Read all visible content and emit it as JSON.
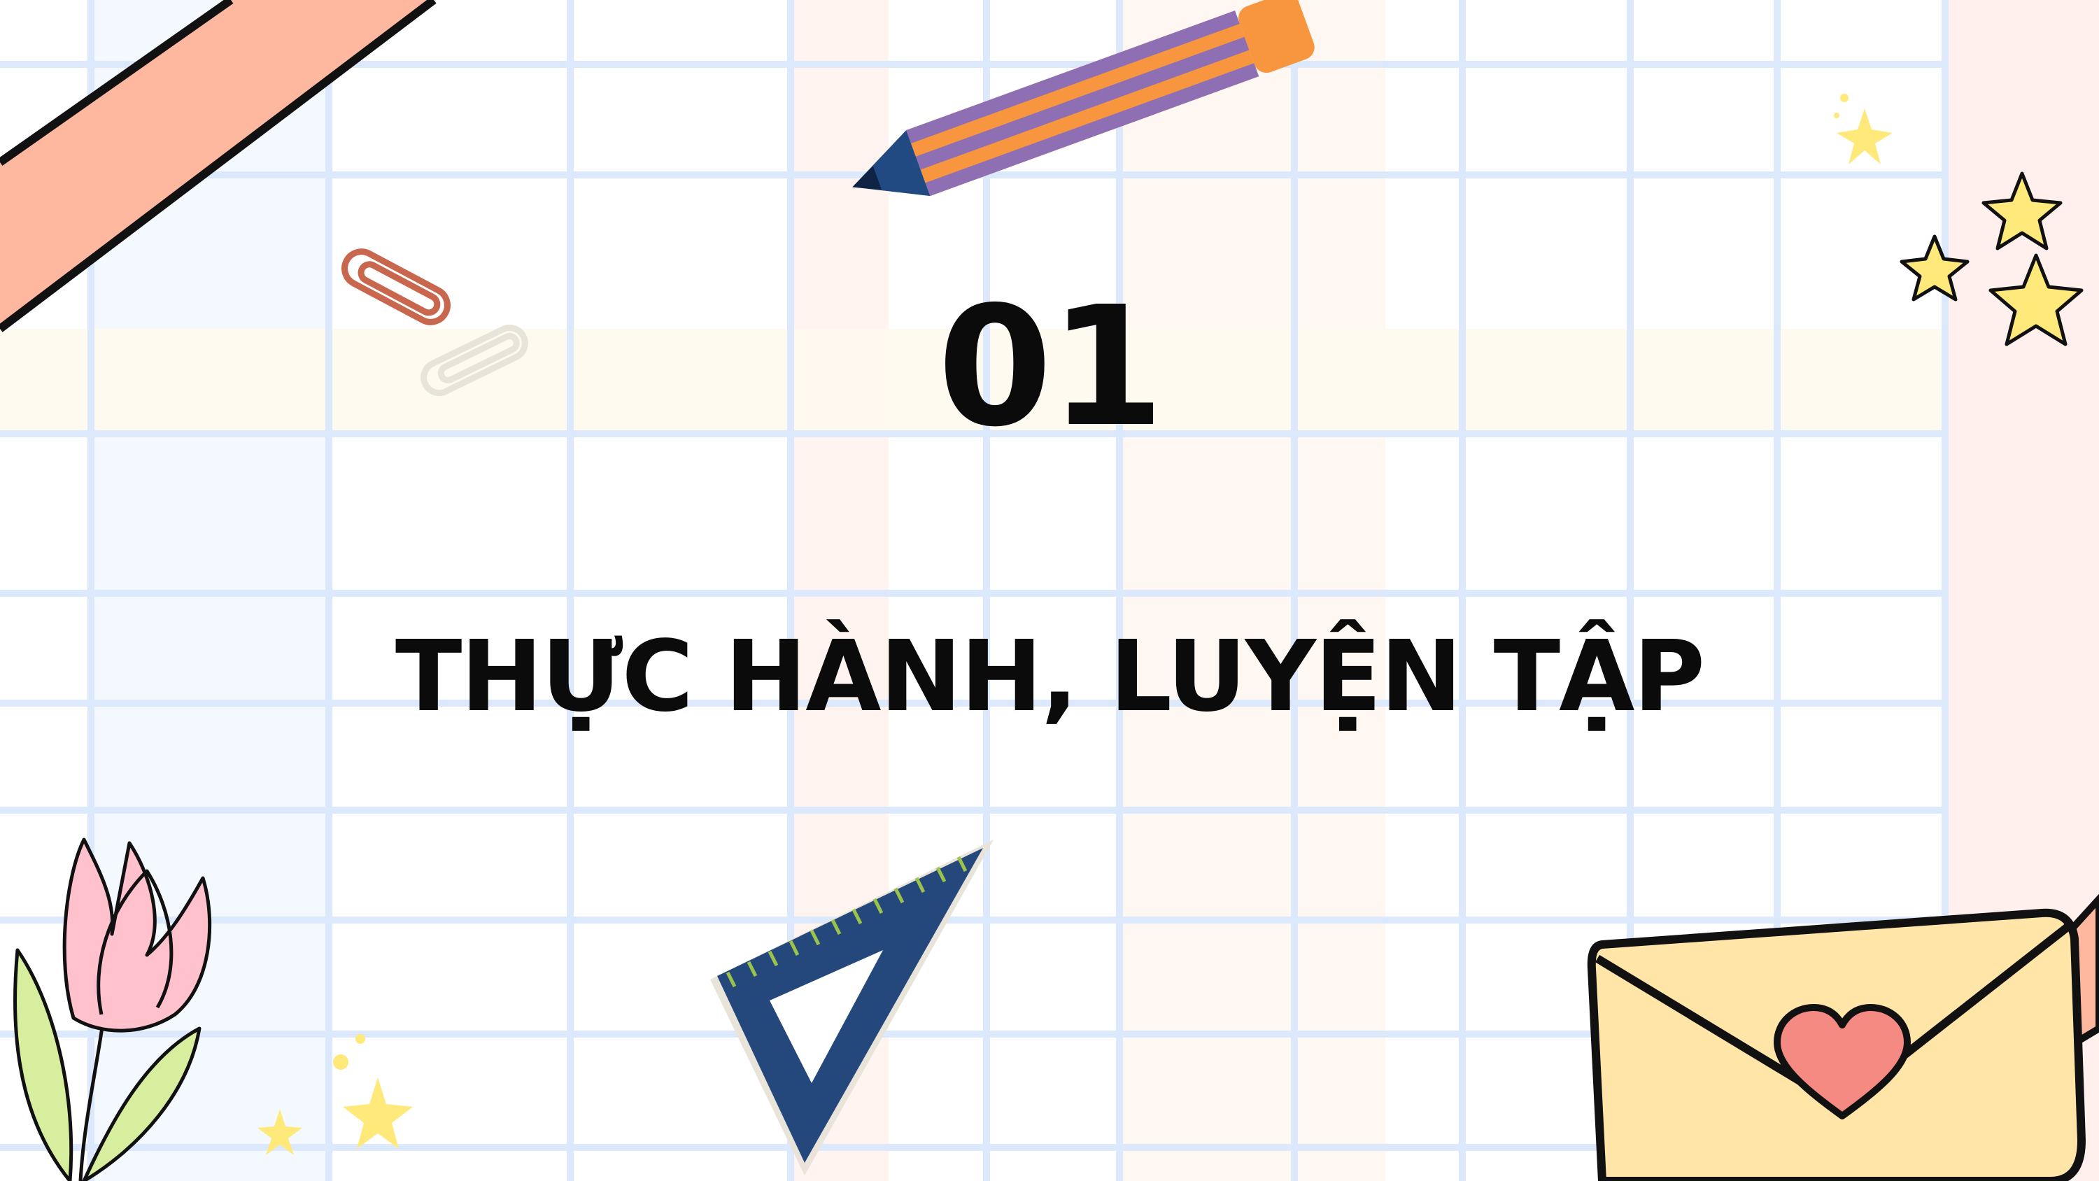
{
  "slide": {
    "number": "01",
    "title": "THỰC HÀNH, LUYỆN TẬP"
  },
  "theme": {
    "grid_line": "#dbe7fb",
    "ruler_fill": "#ffb8a0",
    "pencil_body": "#8f6fb3",
    "pencil_stripe": "#f7963e",
    "pencil_tip": "#224a82",
    "triangle_ruler": "#24487c",
    "ruler_ticks": "#9bc24b",
    "star_fill": "#ffe97a",
    "envelope_fill": "#ffe5a8",
    "heart_fill": "#f58a83",
    "tulip_petal": "#ffc2cc",
    "leaf_fill": "#d8ee9f",
    "text": "#0b0b0b"
  },
  "decorations": [
    "ruler-strip",
    "pencil-icon",
    "paper-clip-icon",
    "paper-clip-faded-icon",
    "sparkle-stars-icon",
    "triangle-ruler-icon",
    "tulip-flower-icon",
    "envelope-heart-icon"
  ]
}
